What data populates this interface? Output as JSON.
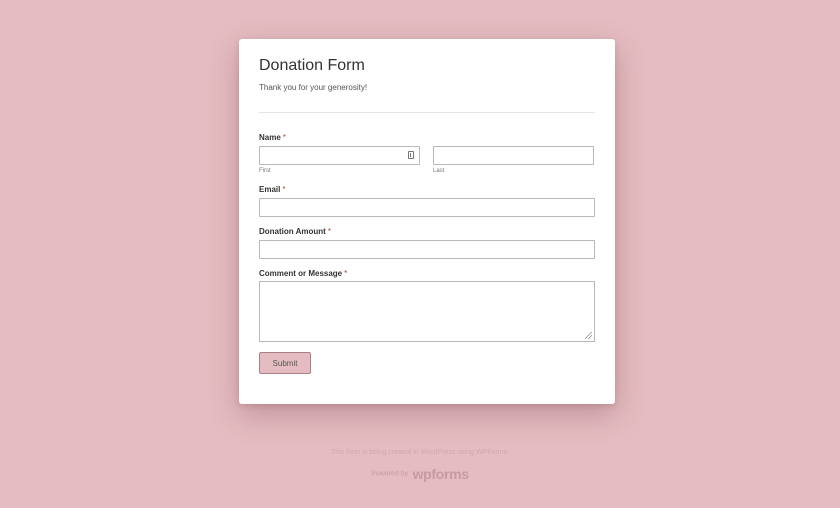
{
  "form": {
    "title": "Donation Form",
    "description": "Thank you for your generosity!",
    "required_marker": "*",
    "fields": {
      "name": {
        "label": "Name",
        "first_sublabel": "First",
        "last_sublabel": "Last",
        "first_value": "",
        "last_value": ""
      },
      "email": {
        "label": "Email",
        "value": ""
      },
      "donation_amount": {
        "label": "Donation Amount",
        "value": ""
      },
      "message": {
        "label": "Comment or Message",
        "value": ""
      }
    },
    "submit_label": "Submit"
  },
  "footer": {
    "note": "This form is being created in WordPress using WPForms.",
    "brand_prefix": "Powered by",
    "brand_logo": "wpforms"
  },
  "colors": {
    "background": "#e5bcc1",
    "card": "#ffffff",
    "required": "#c0392b",
    "button": "#e5bcc1"
  },
  "icons": {
    "contact_card": "contact-card-icon",
    "resize_handle": "resize-handle-icon"
  }
}
